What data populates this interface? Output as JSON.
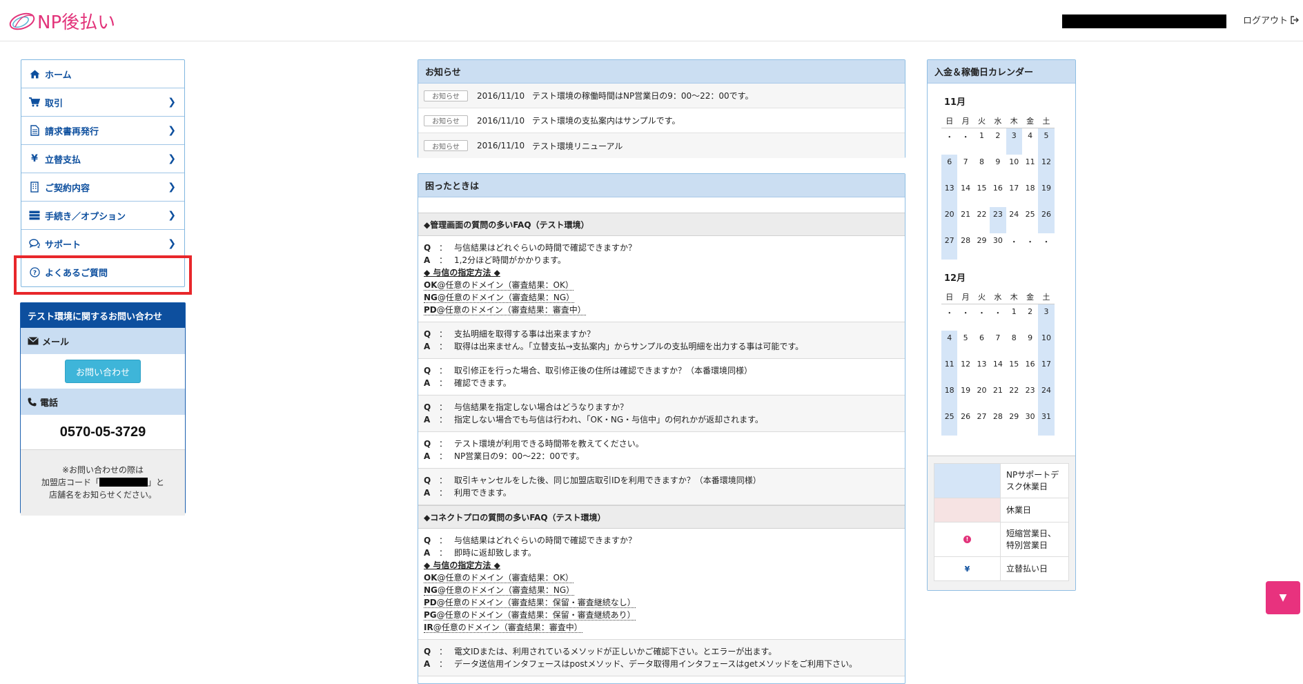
{
  "header": {
    "logo_text": "NP後払い",
    "logout_label": "ログアウト"
  },
  "nav": {
    "items": [
      {
        "label": "ホーム"
      },
      {
        "label": "取引"
      },
      {
        "label": "請求書再発行"
      },
      {
        "label": "立替支払"
      },
      {
        "label": "ご契約内容"
      },
      {
        "label": "手続き／オプション"
      },
      {
        "label": "サポート"
      },
      {
        "label": "よくあるご質問"
      }
    ]
  },
  "contact": {
    "title": "テスト環境に関するお問い合わせ",
    "mail_label": "メール",
    "inquiry_button": "お問い合わせ",
    "phone_label": "電話",
    "phone_number": "0570-05-3729",
    "note_line1": "※お問い合わせの際は",
    "note_line2a": "加盟店コード「",
    "note_line2b": "」と",
    "note_line3": "店舗名をお知らせください。"
  },
  "news": {
    "title": "お知らせ",
    "items": [
      {
        "tag": "お知らせ",
        "date": "2016/11/10",
        "text": "テスト環境の稼働時間はNP営業日の9：00〜22：00です。"
      },
      {
        "tag": "お知らせ",
        "date": "2016/11/10",
        "text": "テスト環境の支払案内はサンプルです。"
      },
      {
        "tag": "お知らせ",
        "date": "2016/11/10",
        "text": "テスト環境リニューアル"
      }
    ]
  },
  "faq": {
    "title": "困ったときは",
    "section1_title": "◆管理画面の質問の多いFAQ（テスト環境）",
    "section2_title": "◆コネクトプロの質問の多いFAQ（テスト環境）",
    "q_key": "Q",
    "a_key": "A",
    "colon": "：",
    "spec_heading": "◆ 与信の指定方法 ◆",
    "s1": {
      "q1": "与信結果はどれぐらいの時間で確認できますか？",
      "a1": "1,2分ほど時間がかかります。",
      "spec": [
        {
          "b": "OK",
          "t": "@任意のドメイン（審査結果：OK）"
        },
        {
          "b": "NG",
          "t": "@任意のドメイン（審査結果：NG）"
        },
        {
          "b": "PD",
          "t": "@任意のドメイン（審査結果：審査中）"
        }
      ],
      "q2": "支払明細を取得する事は出来ますか？",
      "a2": "取得は出来ません。「立替支払→支払案内」からサンプルの支払明細を出力する事は可能です。",
      "q3": "取引修正を行った場合、取引修正後の住所は確認できますか？（本番環境同様）",
      "a3": "確認できます。",
      "q4": "与信結果を指定しない場合はどうなりますか？",
      "a4": "指定しない場合でも与信は行われ、「OK・NG・与信中」の何れかが返却されます。",
      "q5": "テスト環境が利用できる時間帯を教えてください。",
      "a5": "NP営業日の9：00〜22：00です。",
      "q6": "取引キャンセルをした後、同じ加盟店取引IDを利用できますか？（本番環境同様）",
      "a6": "利用できます。"
    },
    "s2": {
      "q1": "与信結果はどれぐらいの時間で確認できますか？",
      "a1": "即時に返却致します。",
      "spec": [
        {
          "b": "OK",
          "t": "@任意のドメイン（審査結果：OK）"
        },
        {
          "b": "NG",
          "t": "@任意のドメイン（審査結果：NG）"
        },
        {
          "b": "PD",
          "t": "@任意のドメイン（審査結果：保留・審査継続なし）"
        },
        {
          "b": "PG",
          "t": "@任意のドメイン（審査結果：保留・審査継続あり）"
        },
        {
          "b": "IR",
          "t": "@任意のドメイン（審査結果：審査中）"
        }
      ],
      "q2": "電文IDまたは、利用されているメソッドが正しいかご確認下さい。とエラーが出ます。",
      "a2": "データ送信用インタフェースはpostメソッド、データ取得用インタフェースはgetメソッドをご利用下さい。"
    }
  },
  "calendar": {
    "title": "入金＆稼働日カレンダー",
    "weekdays": [
      "日",
      "月",
      "火",
      "水",
      "木",
      "金",
      "土"
    ],
    "months": [
      {
        "name": "11月",
        "days": [
          "・",
          "・",
          "1",
          "2",
          "3",
          "4",
          "5",
          "6",
          "7",
          "8",
          "9",
          "10",
          "11",
          "12",
          "13",
          "14",
          "15",
          "16",
          "17",
          "18",
          "19",
          "20",
          "21",
          "22",
          "23",
          "24",
          "25",
          "26",
          "27",
          "28",
          "29",
          "30",
          "・",
          "・",
          "・"
        ],
        "highlighted": [
          "3",
          "5",
          "6",
          "12",
          "13",
          "19",
          "20",
          "23",
          "26",
          "27"
        ]
      },
      {
        "name": "12月",
        "days": [
          "・",
          "・",
          "・",
          "・",
          "1",
          "2",
          "3",
          "4",
          "5",
          "6",
          "7",
          "8",
          "9",
          "10",
          "11",
          "12",
          "13",
          "14",
          "15",
          "16",
          "17",
          "18",
          "19",
          "20",
          "21",
          "22",
          "23",
          "24",
          "25",
          "26",
          "27",
          "28",
          "29",
          "30",
          "31"
        ],
        "highlighted": [
          "3",
          "4",
          "10",
          "11",
          "17",
          "18",
          "24",
          "25",
          "31"
        ]
      }
    ],
    "legend": [
      {
        "label": "NPサポートデスク休業日",
        "swatch_color": "#d5e5f7"
      },
      {
        "label": "休業日",
        "swatch_color": "#f6e3e3"
      },
      {
        "label": "短縮営業日、特別営業日",
        "icon": "exclamation-icon"
      },
      {
        "label": "立替払い日",
        "icon": "yen-icon"
      }
    ],
    "legend_icon_text": {
      "exclamation": "!",
      "yen": "¥"
    }
  },
  "float_button": {
    "label": "▼"
  },
  "colors": {
    "brand": "#e2337a",
    "nav_text": "#0d4f9e",
    "accent_blue": "#3eb5d9",
    "highlight": "#e8272b"
  }
}
